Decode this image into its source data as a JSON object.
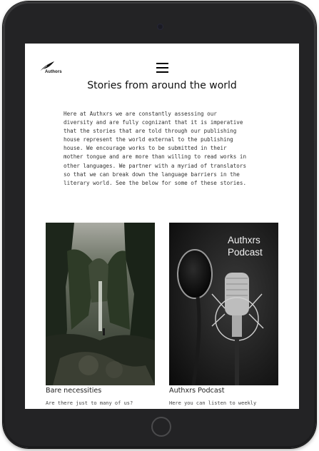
{
  "header": {
    "logo_text": "Authors",
    "menu_icon": "hamburger-menu-icon"
  },
  "main": {
    "title": "Stories from around the world",
    "intro": "Here at Authxrs we are constantly assessing our\ndiversity and are fully cognizant that it is imperative\nthat the stories that are told through our publishing\nhouse represent the world external to the publishing\nhouse. We encourage works to be submitted in their\nmother tongue and are more than willing to read works in\nother languages. We partner with a myriad of translators\nso that we can break down the language barriers in the\nliterary world. See the below for some of these stories."
  },
  "cards": [
    {
      "title": "Bare necessities",
      "description": "Are there just to many of us?"
    },
    {
      "title": "Authxrs Podcast",
      "description": "Here you can listen to weekly",
      "image_label_line1": "Authxrs",
      "image_label_line2": "Podcast"
    }
  ]
}
